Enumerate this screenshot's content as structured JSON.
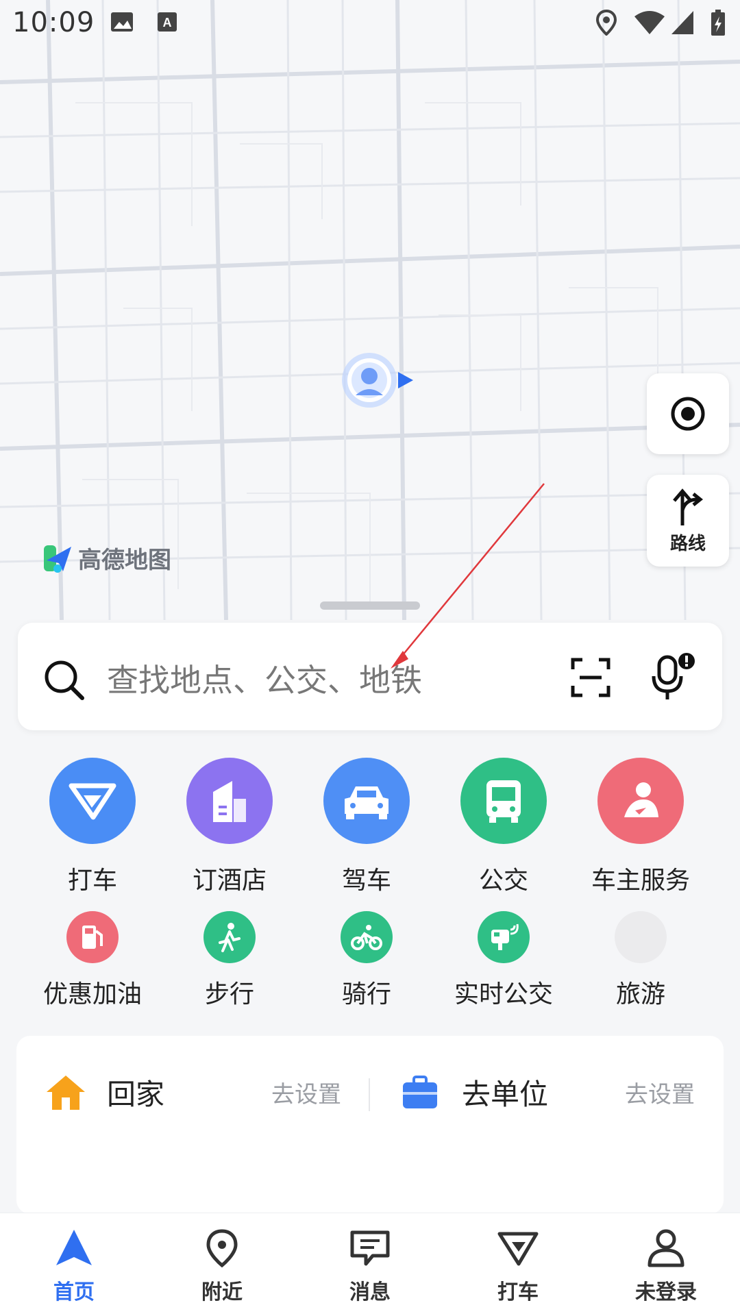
{
  "status_bar": {
    "time": "10:09"
  },
  "map": {
    "logo_text": "高德地图"
  },
  "side_buttons": {
    "route_label": "路线"
  },
  "search": {
    "placeholder": "查找地点、公交、地铁"
  },
  "quick_row1": [
    {
      "label": "打车",
      "icon": "taxi-icon",
      "color": "#4a8df5"
    },
    {
      "label": "订酒店",
      "icon": "hotel-icon",
      "color": "#8c73f0"
    },
    {
      "label": "驾车",
      "icon": "car-icon",
      "color": "#4f8ff5"
    },
    {
      "label": "公交",
      "icon": "bus-icon",
      "color": "#2fbf86"
    },
    {
      "label": "车主服务",
      "icon": "car-owner-icon",
      "color": "#ef6b78"
    }
  ],
  "quick_row2": [
    {
      "label": "优惠加油",
      "icon": "fuel-icon",
      "color": "#ef6b78"
    },
    {
      "label": "步行",
      "icon": "walk-icon",
      "color": "#2fbf86"
    },
    {
      "label": "骑行",
      "icon": "bike-icon",
      "color": "#2fbf86"
    },
    {
      "label": "实时公交",
      "icon": "realtime-bus-icon",
      "color": "#2fbf86"
    },
    {
      "label": "旅游",
      "icon": "travel-icon",
      "color": "#ebebed"
    }
  ],
  "shortcuts": {
    "home_label": "回家",
    "home_action": "去设置",
    "work_label": "去单位",
    "work_action": "去设置"
  },
  "bottom_nav": [
    {
      "label": "首页",
      "icon": "home-nav-icon",
      "active": true
    },
    {
      "label": "附近",
      "icon": "nearby-icon",
      "active": false
    },
    {
      "label": "消息",
      "icon": "message-icon",
      "active": false
    },
    {
      "label": "打车",
      "icon": "taxi-nav-icon",
      "active": false
    },
    {
      "label": "未登录",
      "icon": "user-icon",
      "active": false
    }
  ],
  "colors": {
    "accent": "#2f6ff0",
    "home_orange": "#f7a21b",
    "work_blue": "#3d7ef2"
  }
}
